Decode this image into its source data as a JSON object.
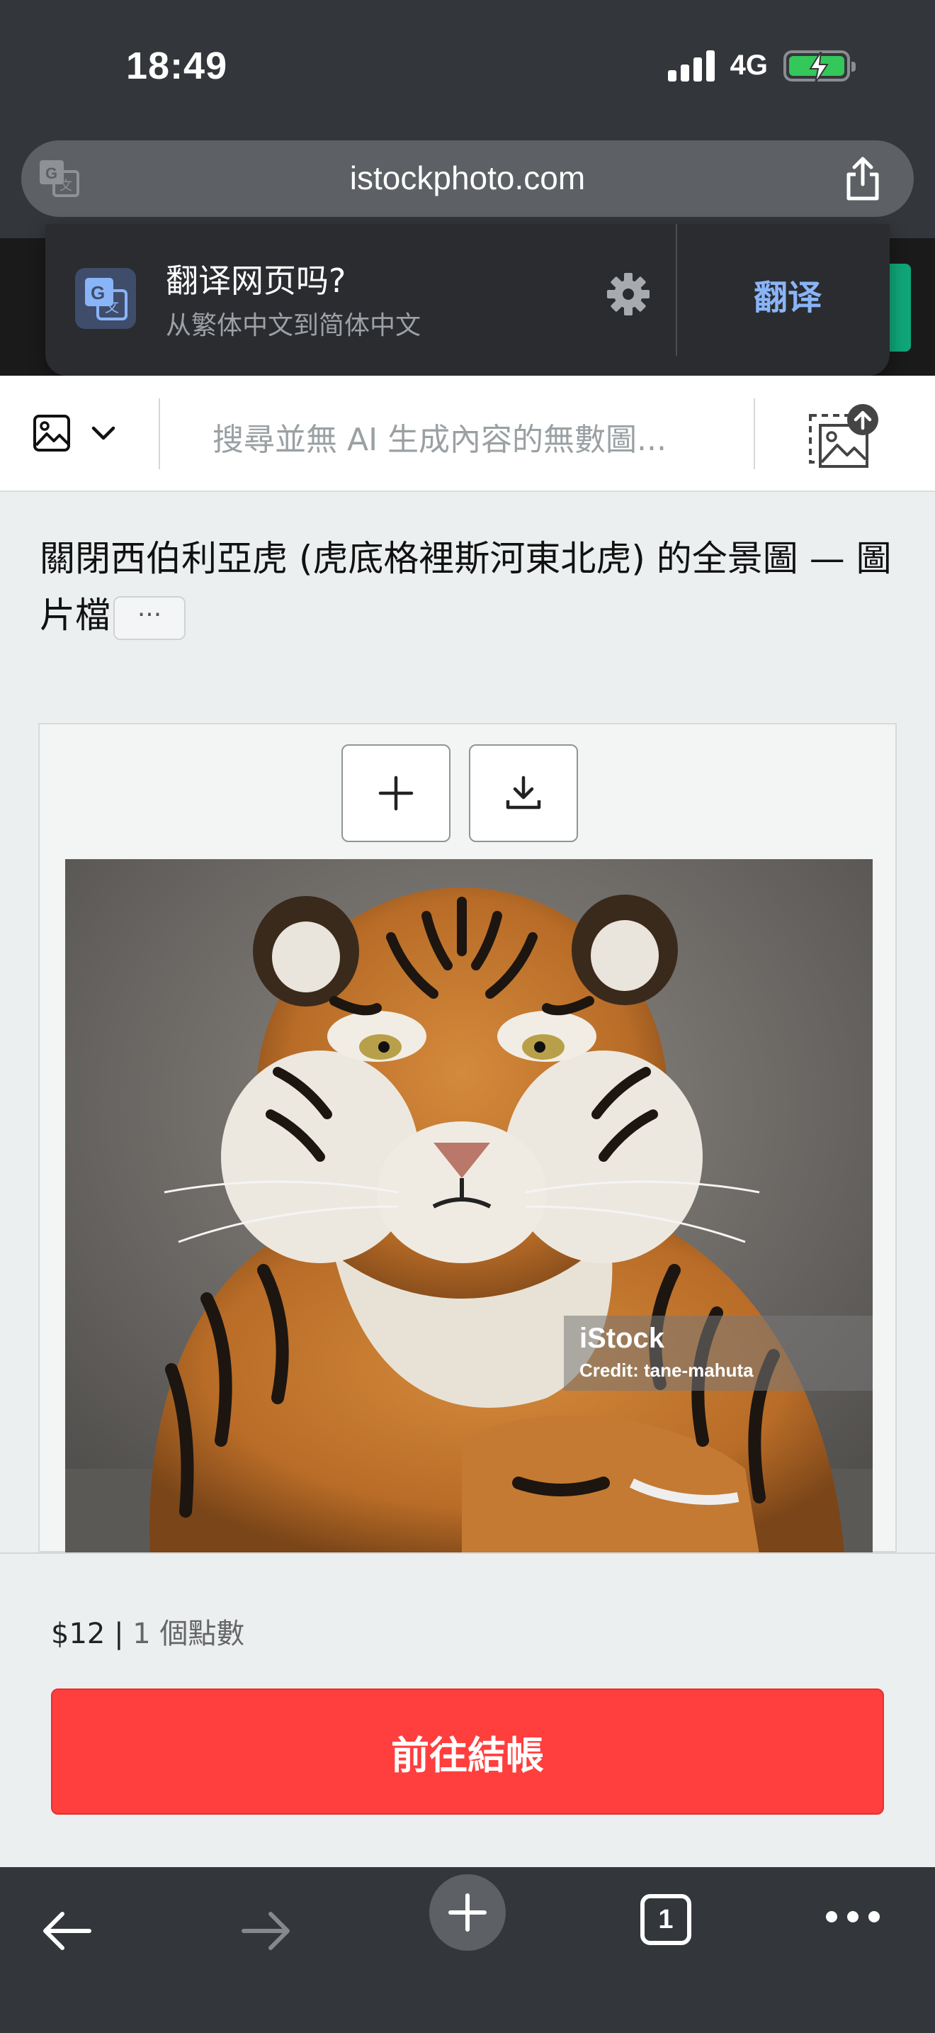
{
  "status_bar": {
    "time": "18:49",
    "network": "4G"
  },
  "address_bar": {
    "url": "istockphoto.com"
  },
  "translate_popup": {
    "title": "翻译网页吗?",
    "subtitle": "从繁体中文到简体中文",
    "translate_label": "翻译"
  },
  "search": {
    "placeholder": "搜尋並無 AI 生成內容的無數圖..."
  },
  "page": {
    "title": "關閉西伯利亞虎 (虎底格裡斯河東北虎) 的全景圖 — 圖片檔",
    "more_label": "···"
  },
  "image": {
    "watermark_brand": "iStock",
    "watermark_credit": "Credit: tane-mahuta"
  },
  "checkout": {
    "price": "$12",
    "separator": " | ",
    "credits": "1 個點數",
    "button_label": "前往結帳"
  },
  "toolbar": {
    "tab_count": "1"
  },
  "colors": {
    "accent_red": "#ff3e3e",
    "translate_blue": "#8ab4f8",
    "brand_green": "#0fa678",
    "chrome_dark": "#33363a"
  }
}
